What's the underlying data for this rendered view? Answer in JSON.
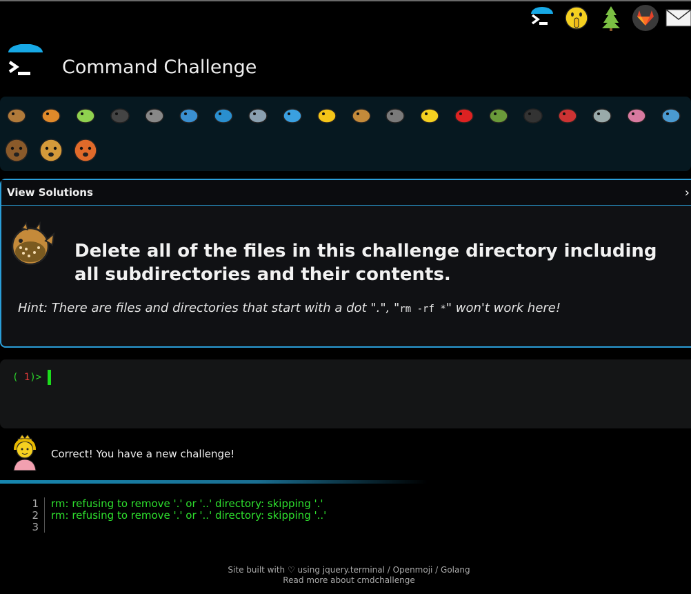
{
  "app_title": "Command Challenge",
  "top_icons": [
    "terminal-icon",
    "shushing-face-icon",
    "tree-icon",
    "gitlab-icon",
    "envelope-icon"
  ],
  "animals_row1": [
    "snail-icon",
    "butterfly-icon",
    "caterpillar-icon",
    "ant-icon",
    "spider-web-icon",
    "whale-icon",
    "dolphin-icon",
    "dolphin-2-icon",
    "fish-icon",
    "tropical-fish-icon",
    "blowfish-icon",
    "wolf-icon",
    "bee-icon",
    "ladybug-icon",
    "cricket-icon",
    "spider-icon",
    "scorpion-icon",
    "fly-icon",
    "worm-icon",
    "microbe-icon"
  ],
  "animals_row2": [
    "monkey-icon",
    "dog-icon",
    "fox-icon"
  ],
  "panel": {
    "header_label": "View Solutions",
    "chevron": "›",
    "challenge_text": "Delete all of the files in this challenge directory including all subdirectories and their contents.",
    "hint_prefix": "Hint: There are files and directories that start with a dot \".\", \"",
    "hint_code": "rm -rf *",
    "hint_suffix": "\" won't work here!"
  },
  "terminal": {
    "prompt_open": "(",
    "prompt_number": "1",
    "prompt_close": ")>"
  },
  "status": {
    "message": "Correct! You have a new challenge!"
  },
  "output": [
    {
      "line": "1",
      "text": "rm: refusing to remove '.' or '..' directory: skipping '.'"
    },
    {
      "line": "2",
      "text": "rm: refusing to remove '.' or '..' directory: skipping '..'"
    },
    {
      "line": "3",
      "text": ""
    }
  ],
  "footer": {
    "line1": "Site built with ♡ using jquery.terminal / Openmoji / Golang",
    "line2": "Read more about cmdchallenge"
  },
  "colors": {
    "accent": "#2a9ed8",
    "prompt_green": "#2bd82b",
    "prompt_red": "#e03a3a",
    "output_green": "#2ee02e"
  }
}
